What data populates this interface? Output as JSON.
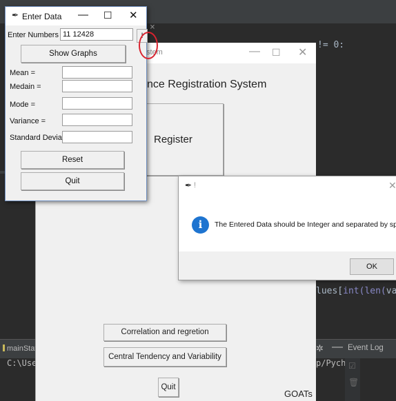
{
  "ide": {
    "tab_close": "×",
    "code_line_top": "!= 0:",
    "code_line_mid_prefix": "lues[",
    "code_line_mid_fn": "int(len(",
    "code_line_mid_suffix": "value",
    "run_tab_label": "mainStat",
    "run_path": "C:\\Use",
    "run_path_right": "p/Pycha",
    "event_log": "Event Log"
  },
  "main_window": {
    "title": "stem",
    "heading": "nce Registration System",
    "register_label": "Register",
    "correlation_label": "Correlation and regretion",
    "central_label": "Central Tendency and Variability",
    "quit_label": "Quit",
    "footer_text": "GOATs"
  },
  "data_window": {
    "title": "Enter Data",
    "enter_numbers_label": "Enter Numbers",
    "enter_numbers_value": "11 12428",
    "warn_label": "!",
    "show_graphs_label": "Show Graphs",
    "mean_label": "Mean  =",
    "median_label": "Medain =",
    "mode_label": "Mode  =",
    "variance_label": "Variance  =",
    "stddev_label": "Standard Deviatio",
    "mean_value": "",
    "median_value": "",
    "mode_value": "",
    "variance_value": "",
    "stddev_value": "",
    "reset_label": "Reset",
    "quit_label": "Quit"
  },
  "message_box": {
    "title": "!",
    "message": "The Entered Data should be Integer and separated by space",
    "ok_label": "OK"
  },
  "colors": {
    "ide_bg": "#2b2b2b",
    "info_icon": "#1e74d0",
    "annotation_circle": "#d9232f"
  }
}
